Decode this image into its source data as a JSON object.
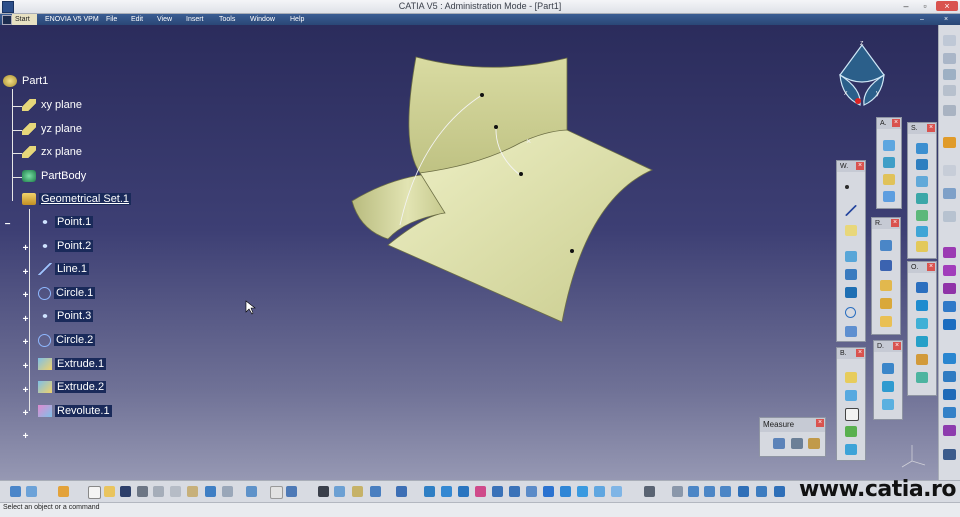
{
  "window": {
    "title": "CATIA V5 : Administration Mode - [Part1]",
    "close": "×"
  },
  "menu": [
    "Start",
    "ENOVIA V5 VPM",
    "File",
    "Edit",
    "View",
    "Insert",
    "Tools",
    "Window",
    "Help"
  ],
  "tree": {
    "root": "Part1",
    "items": [
      {
        "label": "xy plane"
      },
      {
        "label": "yz plane"
      },
      {
        "label": "zx plane"
      },
      {
        "label": "PartBody"
      },
      {
        "label": "Geometrical Set.1"
      },
      {
        "label": "Point.1"
      },
      {
        "label": "Point.2"
      },
      {
        "label": "Line.1"
      },
      {
        "label": "Circle.1"
      },
      {
        "label": "Point.3"
      },
      {
        "label": "Circle.2"
      },
      {
        "label": "Extrude.1"
      },
      {
        "label": "Extrude.2"
      },
      {
        "label": "Revolute.1"
      }
    ]
  },
  "toolbars": {
    "w": "W.",
    "a": "A.",
    "s": "S.",
    "r": "R.",
    "o": "O.",
    "b": "B.",
    "d": "D.",
    "measure": "Measure",
    "close": "×"
  },
  "compass": {
    "x": "x",
    "y": "y",
    "z": "z"
  },
  "status": "Select an object or a command",
  "watermark": "www.catia.ro",
  "colors": {
    "surface": "#e6e8b4",
    "background_top": "#2b2c5c",
    "background_bottom": "#9698b3"
  }
}
